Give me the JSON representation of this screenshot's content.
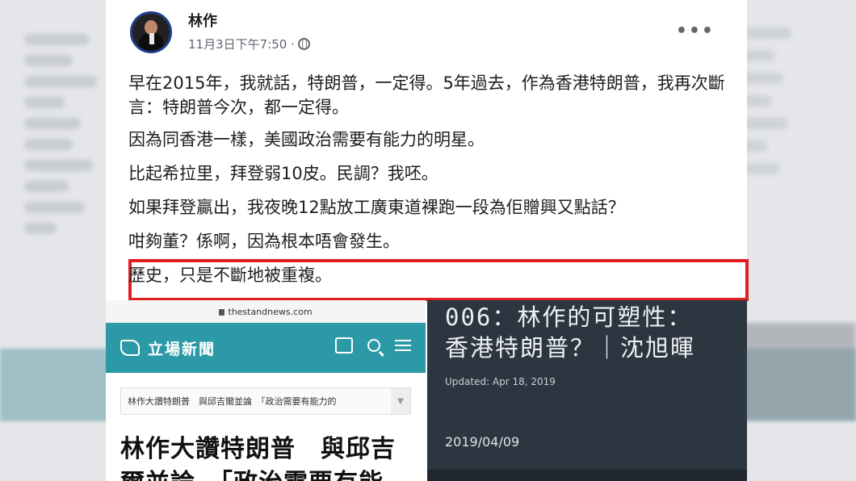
{
  "post": {
    "author": "林作",
    "timestamp": "11月3日下午7:50 ·",
    "more_label": "•••",
    "paragraphs": [
      "早在2015年，我就話，特朗普，一定得。5年過去，作為香港特朗普，我再次斷言：特朗普今次，都一定得。",
      "因為同香港一樣，美國政治需要有能力的明星。",
      "比起希拉里，拜登弱10皮。民調？我呸。",
      "如果拜登贏出，我夜晚12點放工廣東道裸跑一段為佢贈興又點話？",
      "咁夠董？係啊，因為根本唔會發生。",
      "歷史，只是不斷地被重複。"
    ],
    "highlight_color": "#e02020"
  },
  "left_screenshot": {
    "url": "thestandnews.com",
    "brand": "立場新聞",
    "accent_color": "#2b9aa6",
    "breadcrumb": "林作大讚特朗普　與邱吉爾並論　「政治需要有能力的",
    "headline_line1": "林作大讚特朗普　與邱吉",
    "headline_line2": "爾並論　「政治需要有能"
  },
  "right_screenshot": {
    "title_line1": "006：林作的可塑性：",
    "title_line2": "香港特朗普？｜沈旭暉",
    "updated": "Updated: Apr 18, 2019",
    "date": "2019/04/09",
    "background_color": "#2c3641"
  }
}
